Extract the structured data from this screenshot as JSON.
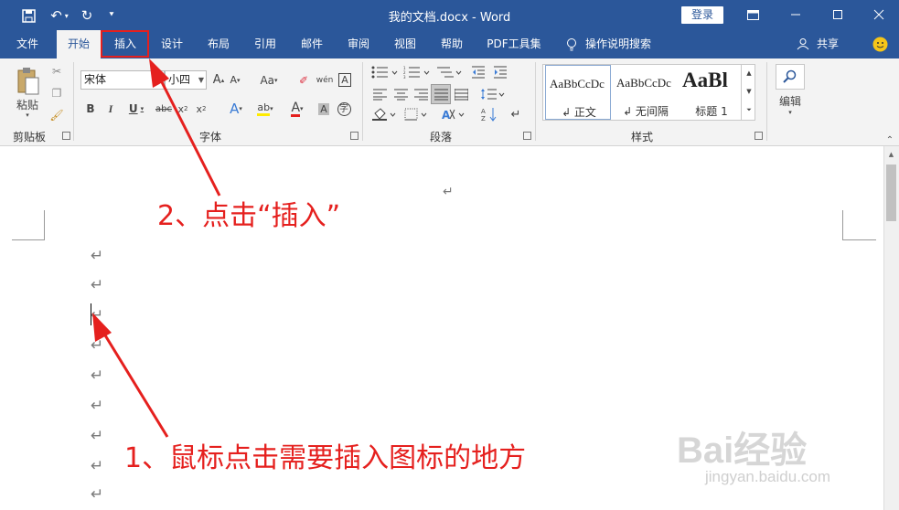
{
  "window": {
    "title": "我的文档.docx - Word",
    "login_label": "登录",
    "controls": [
      "ribbon-display-icon",
      "minimize-icon",
      "maximize-icon",
      "close-icon"
    ]
  },
  "quick_access": [
    "save-icon",
    "undo-icon",
    "redo-icon",
    "customize-icon"
  ],
  "tabs": [
    {
      "label": "文件"
    },
    {
      "label": "开始",
      "active": true
    },
    {
      "label": "插入",
      "highlighted": true
    },
    {
      "label": "设计"
    },
    {
      "label": "布局"
    },
    {
      "label": "引用"
    },
    {
      "label": "邮件"
    },
    {
      "label": "审阅"
    },
    {
      "label": "视图"
    },
    {
      "label": "帮助"
    },
    {
      "label": "PDF工具集"
    },
    {
      "label": "操作说明搜索"
    }
  ],
  "share_label": "共享",
  "ribbon": {
    "clipboard": {
      "label": "剪贴板",
      "paste": "粘贴"
    },
    "font": {
      "label": "字体",
      "font_name": "宋体",
      "font_size": "小四"
    },
    "paragraph": {
      "label": "段落"
    },
    "styles": {
      "label": "样式",
      "items": [
        {
          "preview": "AaBbCcDc",
          "name": "↲ 正文"
        },
        {
          "preview": "AaBbCcDc",
          "name": "↲ 无间隔"
        },
        {
          "preview": "AaBl",
          "name": "标题 1"
        }
      ]
    },
    "editing": {
      "label": "编辑"
    }
  },
  "document": {
    "paragraph_marks": [
      "↵",
      "↵",
      "↵",
      "↵",
      "↵",
      "↵",
      "↵",
      "↵",
      "↵",
      "↵"
    ]
  },
  "annotations": {
    "step1": "1、鼠标点击需要插入图标的地方",
    "step2": "2、点击“插入”",
    "color": "#e5201e"
  },
  "watermark": {
    "brand": "Bai经验",
    "url": "jingyan.baidu.com"
  },
  "colors": {
    "accent": "#2b579a",
    "annotation": "#e5201e"
  }
}
